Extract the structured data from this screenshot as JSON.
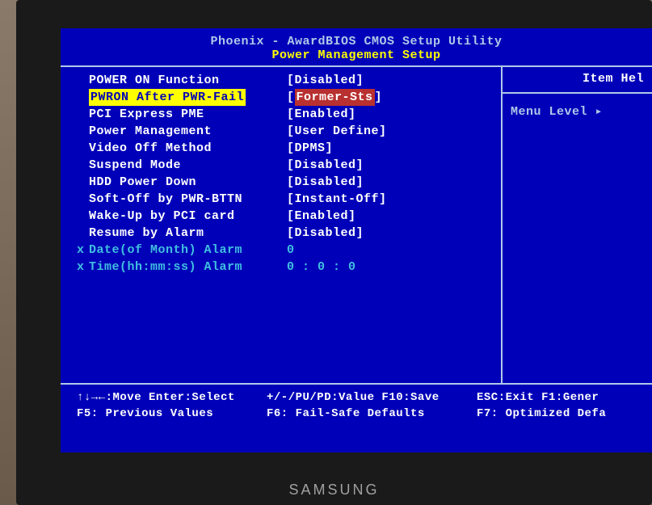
{
  "header": {
    "title_main": "Phoenix - AwardBIOS CMOS Setup Utility",
    "title_sub": "Power Management Setup"
  },
  "settings": [
    {
      "label": "POWER ON Function",
      "value": "[Disabled]",
      "highlighted": false,
      "disabled": false
    },
    {
      "label": "PWRON After PWR-Fail",
      "value_prefix": "[",
      "value_core": "Former-Sts",
      "value_suffix": "]",
      "highlighted": true,
      "disabled": false
    },
    {
      "label": "PCI Express PME",
      "value": "[Enabled]",
      "highlighted": false,
      "disabled": false
    },
    {
      "label": "Power Management",
      "value": "[User Define]",
      "highlighted": false,
      "disabled": false
    },
    {
      "label": "Video Off Method",
      "value": "[DPMS]",
      "highlighted": false,
      "disabled": false
    },
    {
      "label": "Suspend Mode",
      "value": "[Disabled]",
      "highlighted": false,
      "disabled": false
    },
    {
      "label": "HDD Power Down",
      "value": "[Disabled]",
      "highlighted": false,
      "disabled": false
    },
    {
      "label": "Soft-Off by PWR-BTTN",
      "value": "[Instant-Off]",
      "highlighted": false,
      "disabled": false
    },
    {
      "label": "Wake-Up by PCI card",
      "value": "[Enabled]",
      "highlighted": false,
      "disabled": false
    },
    {
      "label": "Resume by Alarm",
      "value": "[Disabled]",
      "highlighted": false,
      "disabled": false
    },
    {
      "label": "Date(of Month) Alarm",
      "value": "  0",
      "highlighted": false,
      "disabled": true,
      "marker": "x"
    },
    {
      "label": "Time(hh:mm:ss) Alarm",
      "value": "  0 :  0 :  0",
      "highlighted": false,
      "disabled": true,
      "marker": "x"
    }
  ],
  "right_panel": {
    "item_help": "Item Hel",
    "menu_level": "Menu Level",
    "arrow": "▸"
  },
  "footer": {
    "row1_left": "↑↓→←:Move  Enter:Select",
    "row1_mid": "+/-/PU/PD:Value  F10:Save",
    "row1_right": "ESC:Exit   F1:Gener",
    "row2_left": "   F5: Previous Values",
    "row2_mid": "F6: Fail-Safe Defaults",
    "row2_right": "F7: Optimized Defa"
  },
  "monitor_brand": "SAMSUNG"
}
